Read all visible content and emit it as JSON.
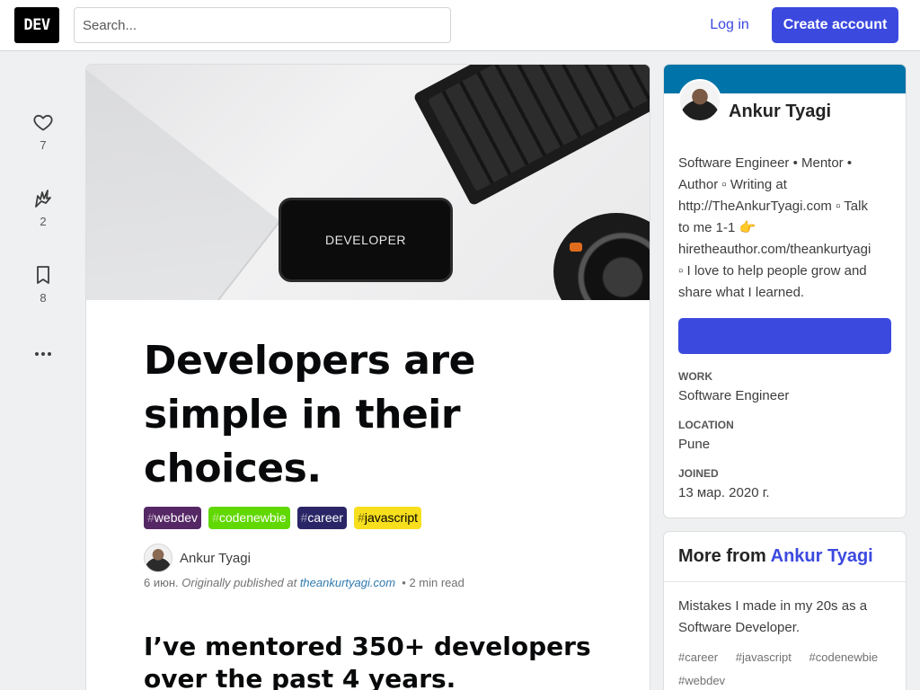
{
  "header": {
    "logo": "DEV",
    "search_placeholder": "Search...",
    "login": "Log in",
    "create_account": "Create account"
  },
  "reactions": [
    {
      "name": "heart",
      "count": "7"
    },
    {
      "name": "unicorn",
      "count": "2"
    },
    {
      "name": "bookmark",
      "count": "8"
    }
  ],
  "article": {
    "cover_text": "DEVELOPER",
    "title": "Developers are simple in their choices.",
    "tags": [
      {
        "label": "webdev",
        "color": "#562765"
      },
      {
        "label": "codenewbie",
        "color": "#61d800"
      },
      {
        "label": "career",
        "color": "#2a2566"
      },
      {
        "label": "javascript",
        "color": "#f7df1e"
      }
    ],
    "author": "Ankur Tyagi",
    "date": "6 июн.",
    "originally": "Originally published at",
    "site": "theankurtyagi.com",
    "read_time": "2 min read",
    "subheading": "I’ve mentored 350+ developers over the past 4 years."
  },
  "profile": {
    "name": "Ankur Tyagi",
    "bio_lines": [
      "Software Engineer • Mentor •",
      "Author ▫ Writing at",
      "http://TheAnkurTyagi.com ▫ Talk",
      "to me 1-1 👉",
      "hiretheauthor.com/theankurtyagi",
      "▫ I love to help people grow and",
      "share what I learned."
    ],
    "fields": [
      {
        "label": "WORK",
        "value": "Software Engineer"
      },
      {
        "label": "LOCATION",
        "value": "Pune"
      },
      {
        "label": "JOINED",
        "value": "13 мар. 2020 г."
      }
    ],
    "band_color": "#0073a8"
  },
  "more_from": {
    "prefix": "More from",
    "author": "Ankur Tyagi",
    "item_title": "Mistakes I made in my 20s as a Software Developer.",
    "item_tags": [
      "career",
      "javascript",
      "codenewbie",
      "webdev"
    ]
  }
}
